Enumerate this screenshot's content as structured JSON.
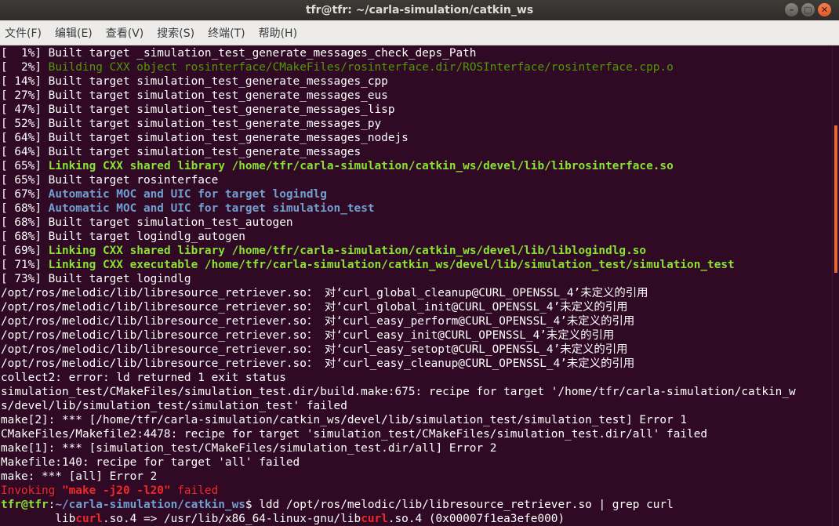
{
  "window": {
    "title": "tfr@tfr: ~/carla-simulation/catkin_ws",
    "buttons": [
      "–",
      "▢",
      "✕"
    ]
  },
  "menu": [
    "文件(F)",
    "编辑(E)",
    "查看(V)",
    "搜索(S)",
    "终端(T)",
    "帮助(H)"
  ],
  "colors": {
    "background": "#300a24",
    "green": "#8ae234",
    "blue": "#729fcf",
    "red": "#ef2929",
    "scroll_thumb": "#e16a33"
  },
  "lines": [
    [
      {
        "t": "[  1%] Built target _simulation_test_generate_messages_check_deps_Path",
        "c": ""
      }
    ],
    [
      {
        "t": "[  2%] ",
        "c": ""
      },
      {
        "t": "Building CXX object rosinterface/CMakeFiles/rosinterface.dir/ROSInterface/rosinterface.cpp.o",
        "c": "gn"
      }
    ],
    [
      {
        "t": "[ 14%] Built target simulation_test_generate_messages_cpp",
        "c": ""
      }
    ],
    [
      {
        "t": "[ 27%] Built target simulation_test_generate_messages_eus",
        "c": ""
      }
    ],
    [
      {
        "t": "[ 47%] Built target simulation_test_generate_messages_lisp",
        "c": ""
      }
    ],
    [
      {
        "t": "[ 52%] Built target simulation_test_generate_messages_py",
        "c": ""
      }
    ],
    [
      {
        "t": "[ 64%] Built target simulation_test_generate_messages_nodejs",
        "c": ""
      }
    ],
    [
      {
        "t": "[ 64%] Built target simulation_test_generate_messages",
        "c": ""
      }
    ],
    [
      {
        "t": "[ 65%] ",
        "c": ""
      },
      {
        "t": "Linking CXX shared library /home/tfr/carla-simulation/catkin_ws/devel/lib/librosinterface.so",
        "c": "gb"
      }
    ],
    [
      {
        "t": "[ 65%] Built target rosinterface",
        "c": ""
      }
    ],
    [
      {
        "t": "[ 67%] ",
        "c": ""
      },
      {
        "t": "Automatic MOC and UIC for target logindlg",
        "c": "bb"
      }
    ],
    [
      {
        "t": "[ 68%] ",
        "c": ""
      },
      {
        "t": "Automatic MOC and UIC for target simulation_test",
        "c": "bb"
      }
    ],
    [
      {
        "t": "[ 68%] Built target simulation_test_autogen",
        "c": ""
      }
    ],
    [
      {
        "t": "[ 68%] Built target logindlg_autogen",
        "c": ""
      }
    ],
    [
      {
        "t": "[ 69%] ",
        "c": ""
      },
      {
        "t": "Linking CXX shared library /home/tfr/carla-simulation/catkin_ws/devel/lib/liblogindlg.so",
        "c": "gb"
      }
    ],
    [
      {
        "t": "[ 71%] ",
        "c": ""
      },
      {
        "t": "Linking CXX executable /home/tfr/carla-simulation/catkin_ws/devel/lib/simulation_test/simulation_test",
        "c": "gb"
      }
    ],
    [
      {
        "t": "[ 73%] Built target logindlg",
        "c": ""
      }
    ],
    [
      {
        "t": "/opt/ros/melodic/lib/libresource_retriever.so： 对‘curl_global_cleanup@CURL_OPENSSL_4’未定义的引用",
        "c": ""
      }
    ],
    [
      {
        "t": "/opt/ros/melodic/lib/libresource_retriever.so： 对‘curl_global_init@CURL_OPENSSL_4’未定义的引用",
        "c": ""
      }
    ],
    [
      {
        "t": "/opt/ros/melodic/lib/libresource_retriever.so： 对‘curl_easy_perform@CURL_OPENSSL_4’未定义的引用",
        "c": ""
      }
    ],
    [
      {
        "t": "/opt/ros/melodic/lib/libresource_retriever.so： 对‘curl_easy_init@CURL_OPENSSL_4’未定义的引用",
        "c": ""
      }
    ],
    [
      {
        "t": "/opt/ros/melodic/lib/libresource_retriever.so： 对‘curl_easy_setopt@CURL_OPENSSL_4’未定义的引用",
        "c": ""
      }
    ],
    [
      {
        "t": "/opt/ros/melodic/lib/libresource_retriever.so： 对‘curl_easy_cleanup@CURL_OPENSSL_4’未定义的引用",
        "c": ""
      }
    ],
    [
      {
        "t": "collect2: error: ld returned 1 exit status",
        "c": ""
      }
    ],
    [
      {
        "t": "simulation_test/CMakeFiles/simulation_test.dir/build.make:675: recipe for target '/home/tfr/carla-simulation/catkin_w",
        "c": ""
      }
    ],
    [
      {
        "t": "s/devel/lib/simulation_test/simulation_test' failed",
        "c": ""
      }
    ],
    [
      {
        "t": "make[2]: *** [/home/tfr/carla-simulation/catkin_ws/devel/lib/simulation_test/simulation_test] Error 1",
        "c": ""
      }
    ],
    [
      {
        "t": "CMakeFiles/Makefile2:4478: recipe for target 'simulation_test/CMakeFiles/simulation_test.dir/all' failed",
        "c": ""
      }
    ],
    [
      {
        "t": "make[1]: *** [simulation_test/CMakeFiles/simulation_test.dir/all] Error 2",
        "c": ""
      }
    ],
    [
      {
        "t": "Makefile:140: recipe for target 'all' failed",
        "c": ""
      }
    ],
    [
      {
        "t": "make: *** [all] Error 2",
        "c": ""
      }
    ],
    [
      {
        "t": "Invoking ",
        "c": "rd"
      },
      {
        "t": "\"make -j20 -l20\"",
        "c": "rdb"
      },
      {
        "t": " failed",
        "c": "rd"
      }
    ],
    [
      {
        "t": "tfr@tfr",
        "c": "pu"
      },
      {
        "t": ":",
        "c": ""
      },
      {
        "t": "~/carla-simulation/catkin_ws",
        "c": "pp"
      },
      {
        "t": "$ ldd /opt/ros/melodic/lib/libresource_retriever.so | grep curl",
        "c": ""
      }
    ],
    [
      {
        "t": "\tlib",
        "c": ""
      },
      {
        "t": "curl",
        "c": "rdb"
      },
      {
        "t": ".so.4 => /usr/lib/x86_64-linux-gnu/lib",
        "c": ""
      },
      {
        "t": "curl",
        "c": "rdb"
      },
      {
        "t": ".so.4 (0x00007f1ea3efe000)",
        "c": ""
      }
    ]
  ]
}
